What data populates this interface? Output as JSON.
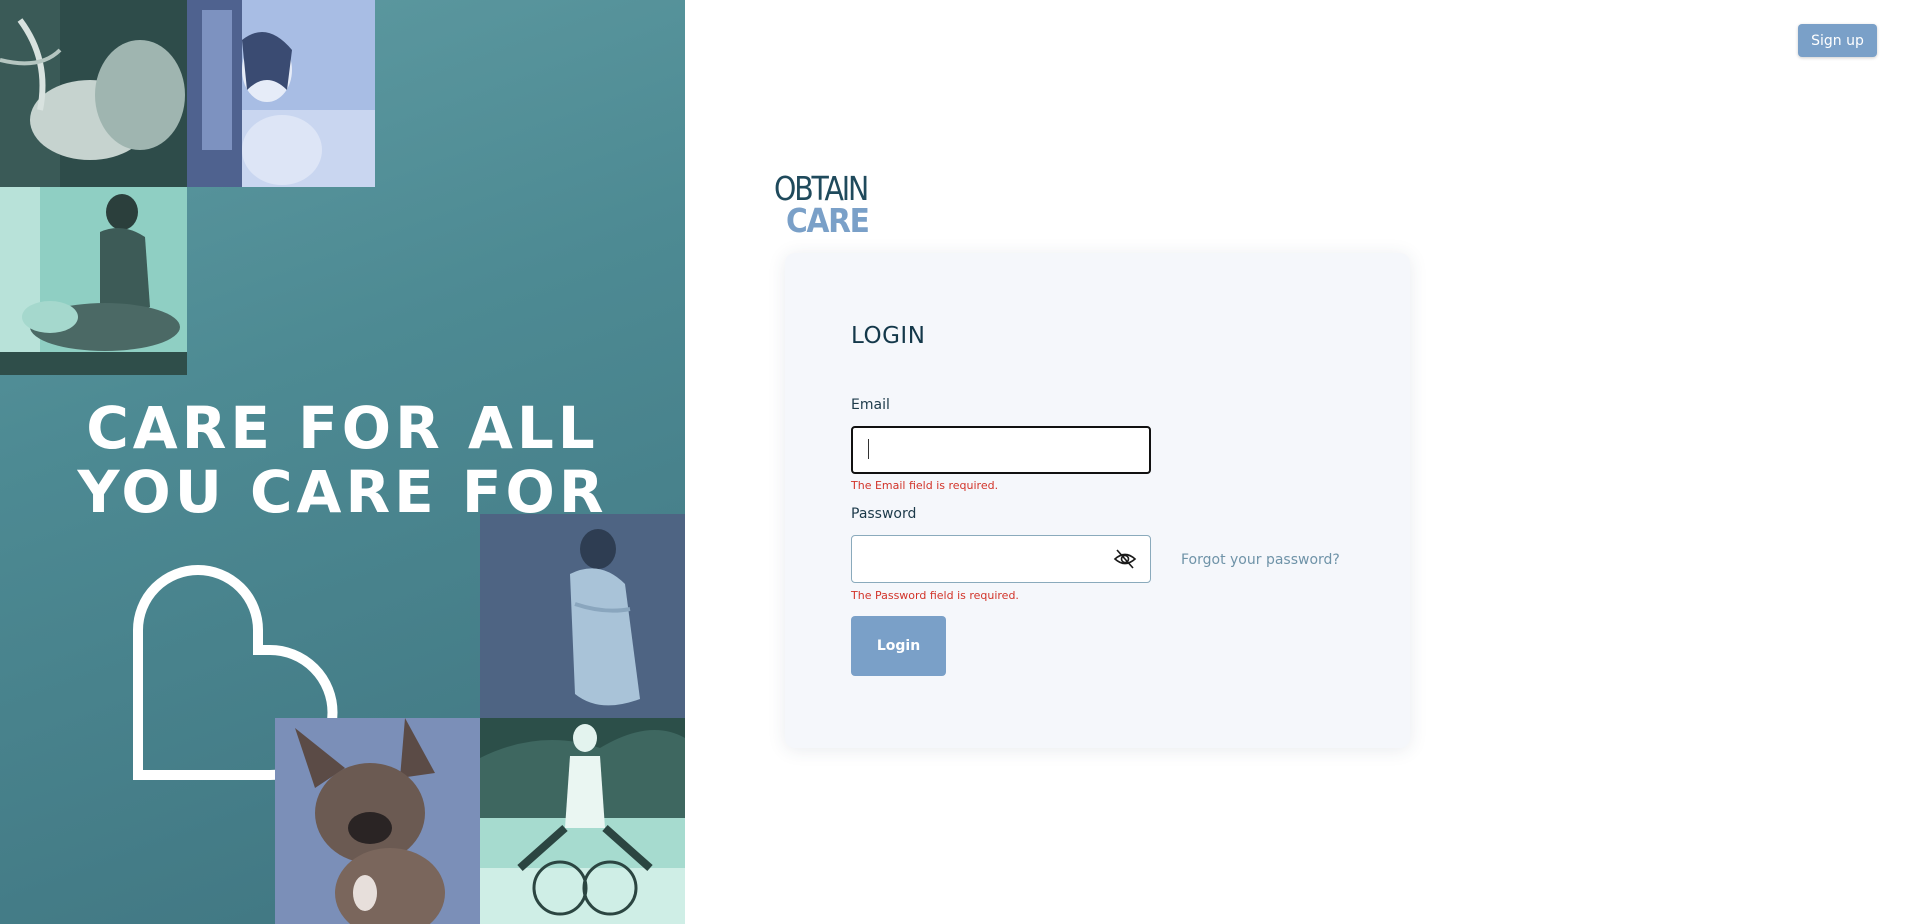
{
  "hero": {
    "slogan_line1": "CARE FOR ALL",
    "slogan_line2": "YOU CARE FOR"
  },
  "header": {
    "signup_label": "Sign up"
  },
  "logo": {
    "top": "OBTAIN",
    "bottom": "CARE"
  },
  "login": {
    "title": "LOGIN",
    "email_label": "Email",
    "email_value": "",
    "email_error": "The Email field is required.",
    "password_label": "Password",
    "password_value": "",
    "password_error": "The Password field is required.",
    "forgot_label": "Forgot your password?",
    "submit_label": "Login"
  },
  "icons": {
    "password_toggle": "eye-slash-icon",
    "hero_heart": "heart-outline-icon"
  },
  "colors": {
    "accent": "#7aa0c8",
    "error": "#d2342a",
    "hero_teal": "#4d8a93",
    "heading": "#14384a"
  }
}
